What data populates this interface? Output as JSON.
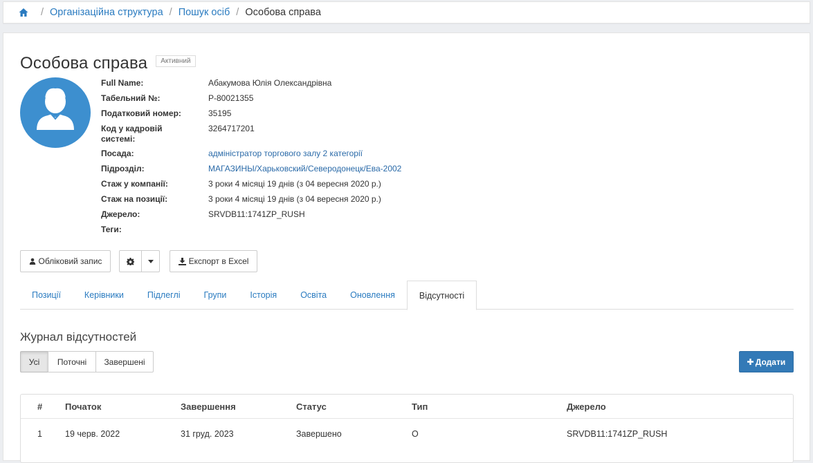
{
  "breadcrumb": {
    "home_icon": "home-icon",
    "items": [
      "Організаційна структура",
      "Пошук осіб"
    ],
    "current": "Особова справа",
    "separator": "/"
  },
  "profile": {
    "title": "Особова справа",
    "status": "Активний",
    "avatar_icon": "user-avatar-icon",
    "avatar_color": "#3d8fcf",
    "fields": [
      {
        "label": "Full Name:",
        "value": "Абакумова Юлія Олександрівна",
        "link": false
      },
      {
        "label": "Табельний №:",
        "value": "P-80021355",
        "link": false
      },
      {
        "label": "Податковий номер:",
        "value": "35195",
        "link": false
      },
      {
        "label": "Код у кадровій системі:",
        "value": "3264717201",
        "link": false
      },
      {
        "label": "Посада:",
        "value": "адміністратор торгового залу 2 категорії",
        "link": true
      },
      {
        "label": "Підрозділ:",
        "value": "МАГАЗИНЫ/Харьковский/Северодонецк/Ева-2002",
        "link": true
      },
      {
        "label": "Стаж у компанії:",
        "value": "3 роки 4 місяці 19 днів (з 04 вересня 2020 р.)",
        "link": false
      },
      {
        "label": "Стаж на позиції:",
        "value": "3 роки 4 місяці 19 днів (з 04 вересня 2020 р.)",
        "link": false
      },
      {
        "label": "Джерело:",
        "value": "SRVDB11:1741ZP_RUSH",
        "link": false
      },
      {
        "label": "Теги:",
        "value": "",
        "link": false
      }
    ]
  },
  "actions": {
    "account_label": "Обліковий запис",
    "export_label": "Експорт в Excel"
  },
  "tabs": [
    "Позиції",
    "Керівники",
    "Підлеглі",
    "Групи",
    "Історія",
    "Освіта",
    "Оновлення",
    "Відсутності"
  ],
  "active_tab": 7,
  "absences": {
    "title": "Журнал відсутностей",
    "filters": [
      "Усі",
      "Поточні",
      "Завершені"
    ],
    "active_filter": 0,
    "add_label": "Додати",
    "columns": [
      "#",
      "Початок",
      "Завершення",
      "Статус",
      "Тип",
      "Джерело"
    ],
    "rows": [
      [
        "1",
        "19 черв. 2022",
        "31 груд. 2023",
        "Завершено",
        "О",
        "SRVDB11:1741ZP_RUSH"
      ]
    ]
  },
  "colors": {
    "link": "#2a7bc0",
    "primary": "#337ab7"
  }
}
